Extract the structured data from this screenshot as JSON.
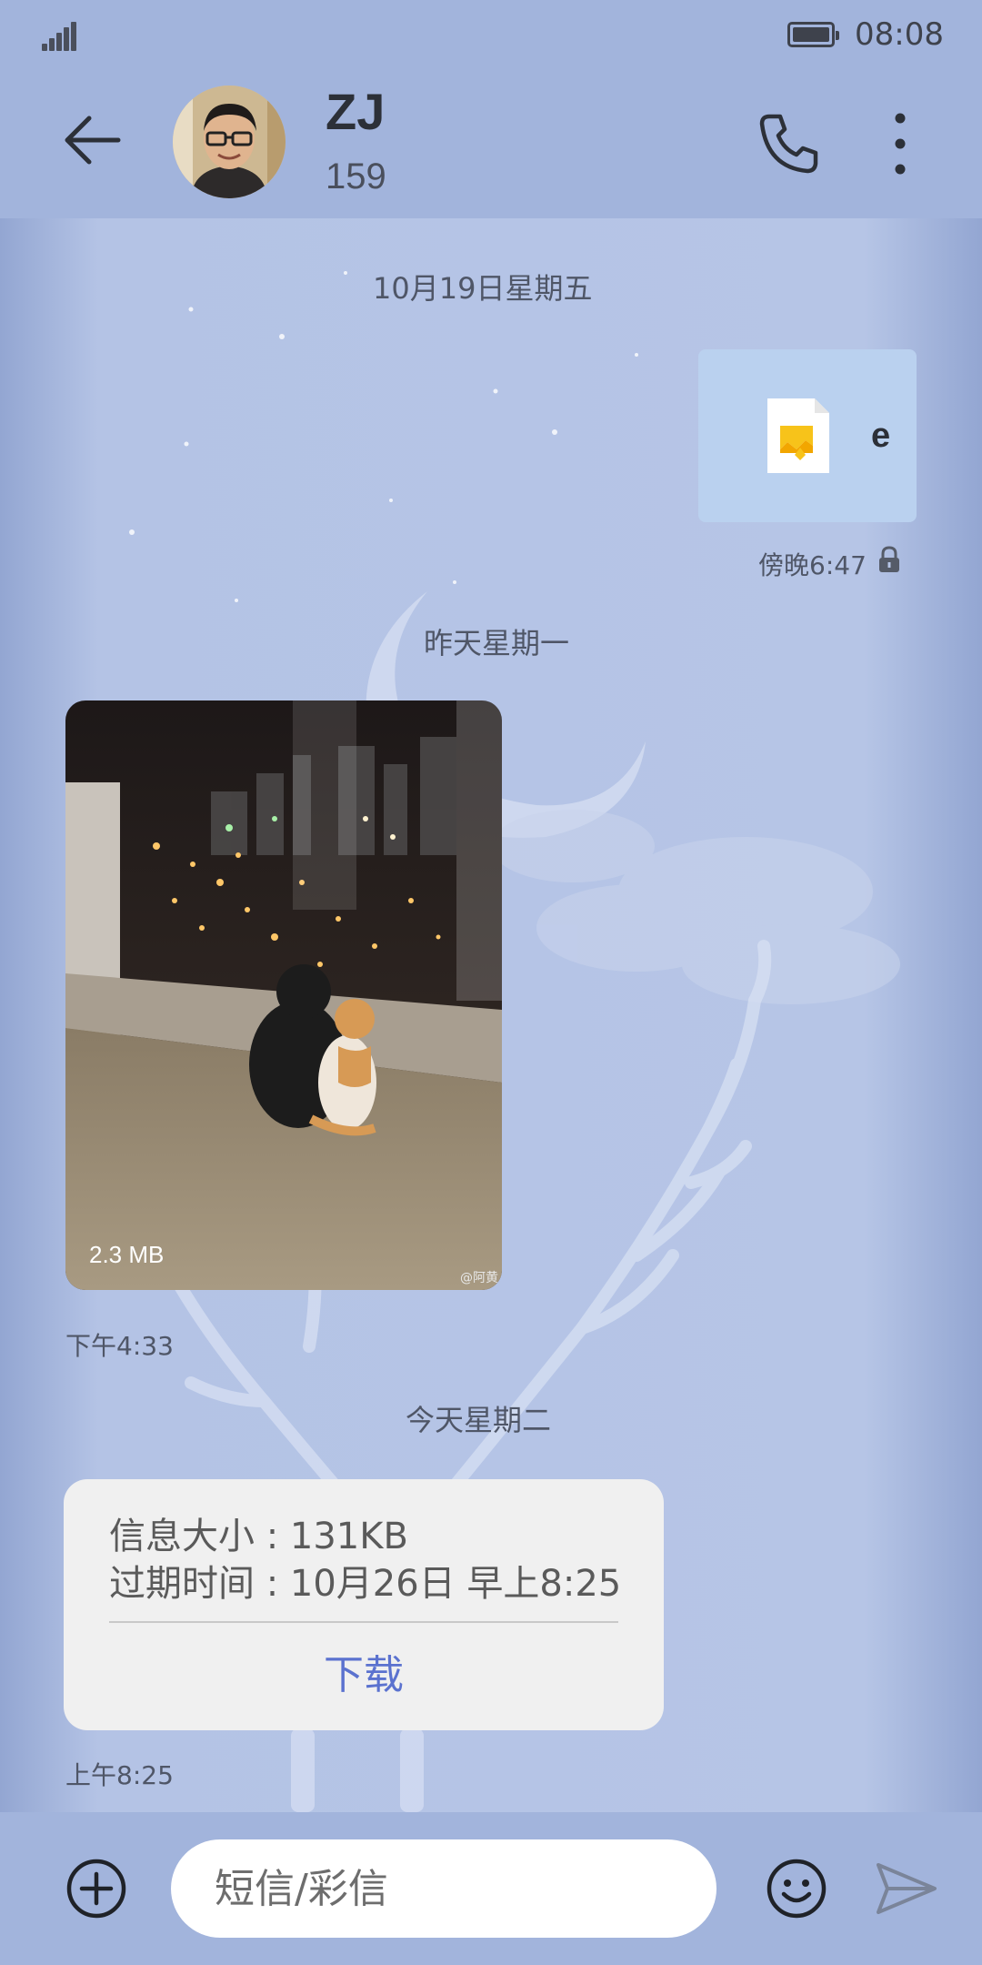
{
  "status_bar": {
    "time": "08:08",
    "signal_icon": "cellular-signal-icon",
    "battery_icon": "battery-icon"
  },
  "header": {
    "back_icon": "arrow-left-icon",
    "contact_name": "ZJ",
    "contact_number": "159",
    "call_icon": "phone-icon",
    "more_icon": "more-vertical-icon"
  },
  "conversation": {
    "day1_label": "10月19日星期五",
    "file_message": {
      "file_name": "e",
      "file_icon": "document-image-icon",
      "time": "傍晚6:47",
      "lock_icon": "lock-icon"
    },
    "day2_label": "昨天星期一",
    "image_message": {
      "size": "2.3 MB",
      "watermark": "@阿黄",
      "time": "下午4:33"
    },
    "day3_label": "今天星期二",
    "mms_notification": {
      "size_line": "信息大小 : 131KB",
      "expiry_line": "过期时间 :  10月26日 早上8:25",
      "download_label": "下载",
      "time": "上午8:25"
    }
  },
  "input_bar": {
    "add_icon": "plus-circle-icon",
    "placeholder": "短信/彩信",
    "emoji_icon": "emoji-icon",
    "send_icon": "send-icon"
  },
  "colors": {
    "header_bg": "#a2b4dc",
    "chat_bg": "#b6c5e6",
    "sent_bubble": "#bad1ef",
    "card_bg": "#f0f0f0",
    "accent": "#5b72cf"
  }
}
